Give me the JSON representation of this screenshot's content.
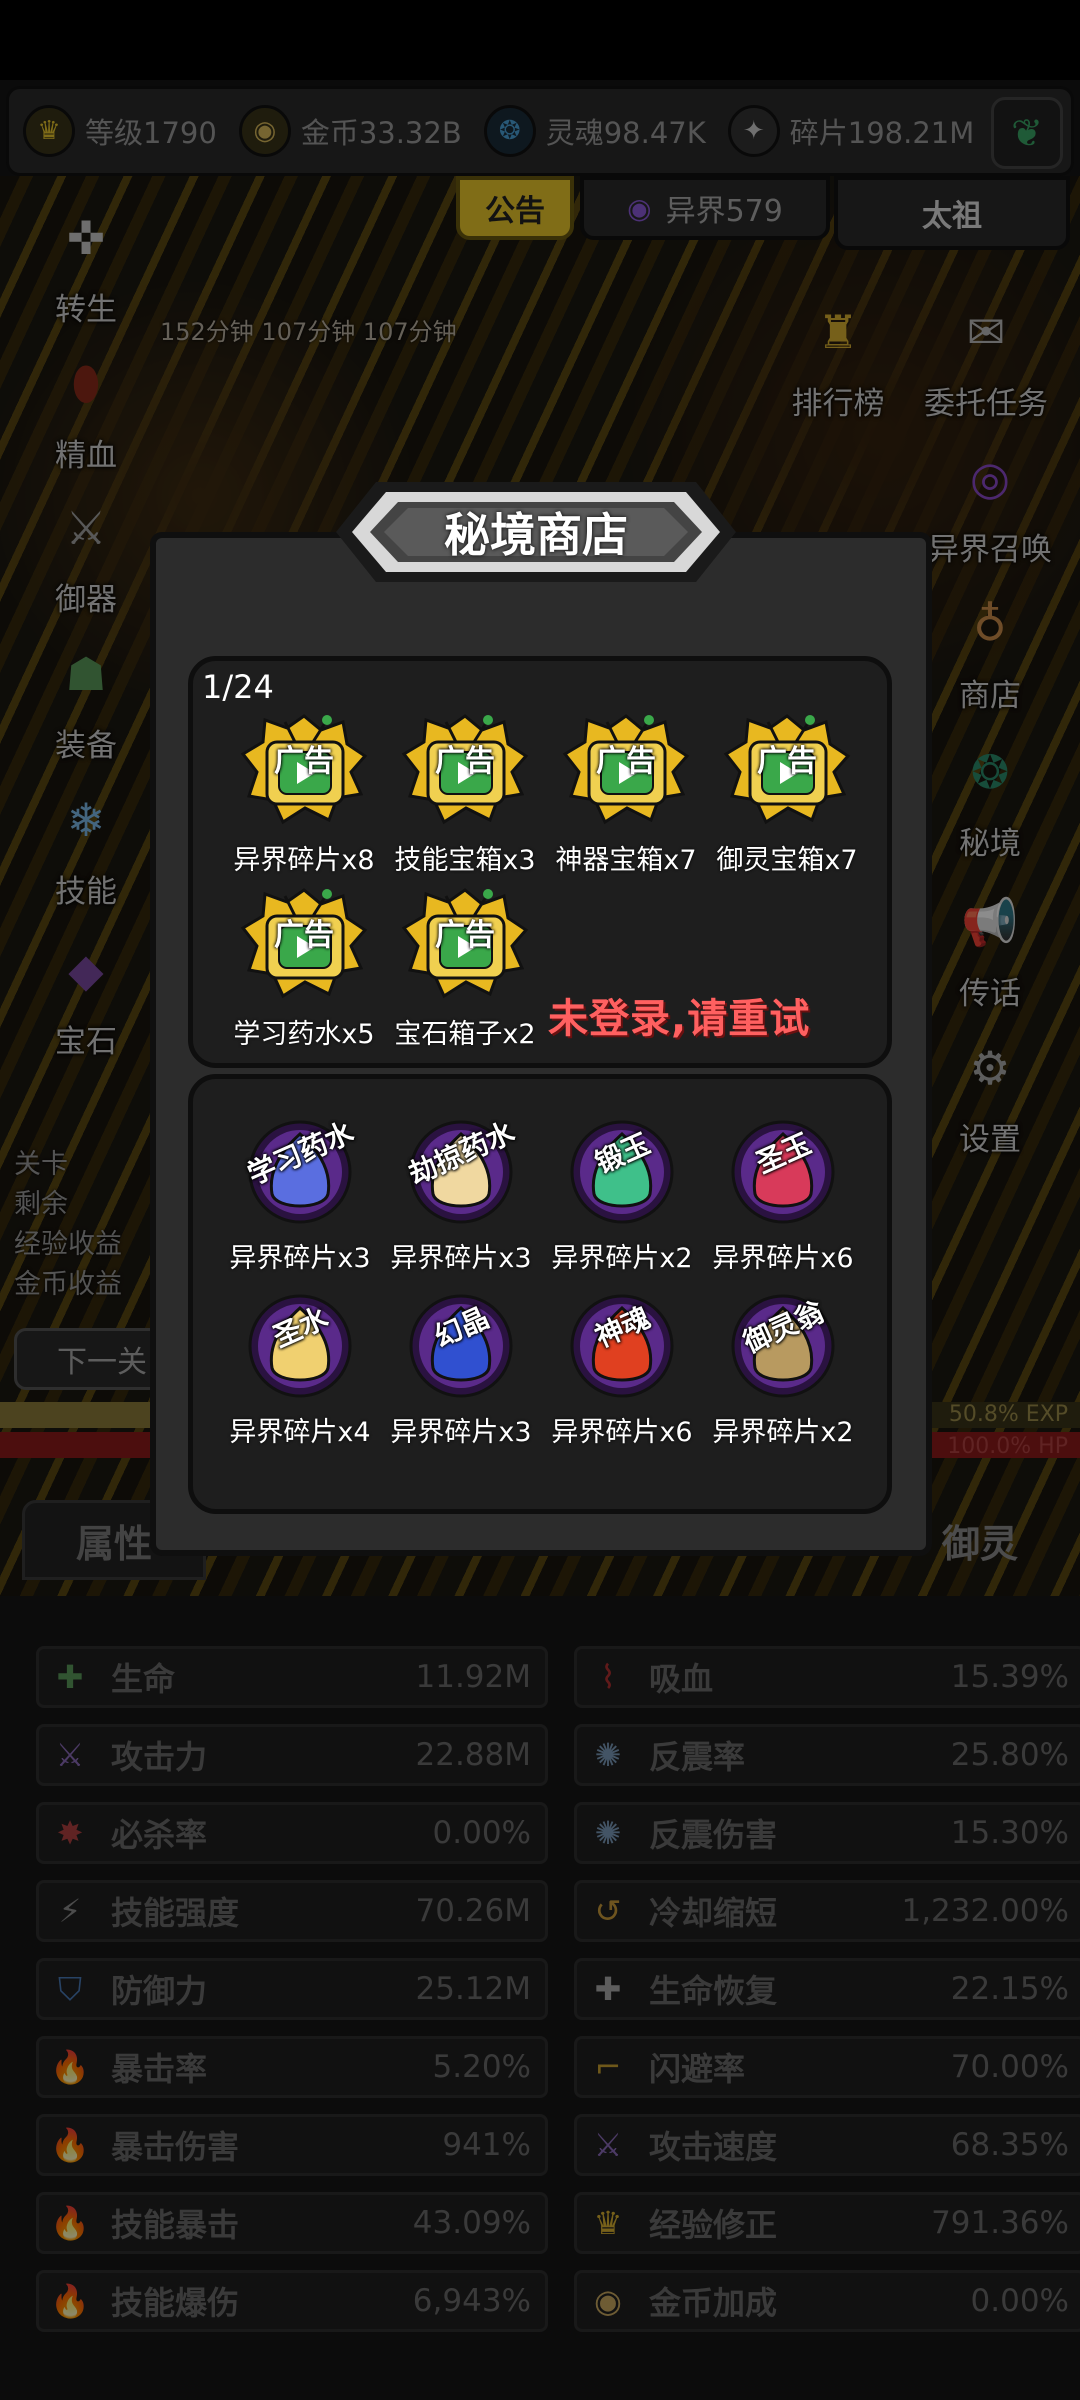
{
  "resources": [
    {
      "icon": "crown-icon",
      "text": "等级1790",
      "color": "#e8c52c"
    },
    {
      "icon": "coin-icon",
      "text": "金币33.32B",
      "color": "#d8b85a"
    },
    {
      "icon": "soul-icon",
      "text": "灵魂98.47K",
      "color": "#4aa0d8"
    },
    {
      "icon": "shard-icon",
      "text": "碎片198.21M",
      "color": "#cccccc"
    }
  ],
  "top_tabs": {
    "notice": "公告",
    "otherworld": "异界579",
    "taizu": "太祖"
  },
  "timers": "152分钟 107分钟 107分钟",
  "left_menu": [
    "转生",
    "精血",
    "御器",
    "装备",
    "技能",
    "宝石"
  ],
  "right_menu": [
    "排行榜",
    "委托任务",
    "异界召唤",
    "商店",
    "秘境",
    "传话",
    "设置"
  ],
  "left_info": [
    "关卡",
    "剩余",
    "经验收益",
    "金币收益"
  ],
  "next_button": "下一关",
  "exp_text": "50.8% EXP",
  "hp_text": "100.0% HP",
  "exp_fraction": 0.508,
  "hp_fraction": 1.0,
  "bottom_tabs": {
    "attr": "属性",
    "yuling": "御灵"
  },
  "stats_left": [
    {
      "icon": "cross-icon",
      "name": "生命",
      "value": "11.92M"
    },
    {
      "icon": "sword-icon",
      "name": "攻击力",
      "value": "22.88M"
    },
    {
      "icon": "crit-kill-icon",
      "name": "必杀率",
      "value": "0.00%"
    },
    {
      "icon": "lightning-icon",
      "name": "技能强度",
      "value": "70.26M"
    },
    {
      "icon": "shield-icon",
      "name": "防御力",
      "value": "25.12M"
    },
    {
      "icon": "flame-icon",
      "name": "暴击率",
      "value": "5.20%"
    },
    {
      "icon": "flame-icon",
      "name": "暴击伤害",
      "value": "941%"
    },
    {
      "icon": "blue-flame-icon",
      "name": "技能暴击",
      "value": "43.09%"
    },
    {
      "icon": "blue-flame-icon",
      "name": "技能爆伤",
      "value": "6,943%"
    }
  ],
  "stats_right": [
    {
      "icon": "bat-icon",
      "name": "吸血",
      "value": "15.39%"
    },
    {
      "icon": "spark-icon",
      "name": "反震率",
      "value": "25.80%"
    },
    {
      "icon": "spark-icon",
      "name": "反震伤害",
      "value": "15.30%"
    },
    {
      "icon": "cooldown-icon",
      "name": "冷却缩短",
      "value": "1,232.00%"
    },
    {
      "icon": "regen-icon",
      "name": "生命恢复",
      "value": "22.15%"
    },
    {
      "icon": "boot-icon",
      "name": "闪避率",
      "value": "70.00%"
    },
    {
      "icon": "attack-speed-icon",
      "name": "攻击速度",
      "value": "68.35%"
    },
    {
      "icon": "crown-icon",
      "name": "经验修正",
      "value": "791.36%"
    },
    {
      "icon": "coin-icon",
      "name": "金币加成",
      "value": "0.00%"
    }
  ],
  "modal": {
    "title": "秘境商店",
    "page": "1/24",
    "ad_badge": "广告",
    "ad_items": [
      "异界碎片x8",
      "技能宝箱x3",
      "神器宝箱x7",
      "御灵宝箱x7",
      "学习药水x5",
      "宝石箱子x2"
    ],
    "login_error": "未登录,请重试",
    "shop_items": [
      {
        "icon_text": "学习药水",
        "label": "异界碎片x3",
        "color": "#5a6ee0"
      },
      {
        "icon_text": "劫掠药水",
        "label": "异界碎片x3",
        "color": "#f0d8a0"
      },
      {
        "icon_text": "锻玉",
        "label": "异界碎片x2",
        "color": "#3fc08a"
      },
      {
        "icon_text": "圣玉",
        "label": "异界碎片x6",
        "color": "#d83a5a"
      },
      {
        "icon_text": "圣水",
        "label": "异界碎片x4",
        "color": "#f0d070"
      },
      {
        "icon_text": "幻晶",
        "label": "异界碎片x3",
        "color": "#3050d0"
      },
      {
        "icon_text": "神魂",
        "label": "异界碎片x6",
        "color": "#e04020"
      },
      {
        "icon_text": "御灵翁",
        "label": "异界碎片x2",
        "color": "#b89a60"
      }
    ]
  }
}
